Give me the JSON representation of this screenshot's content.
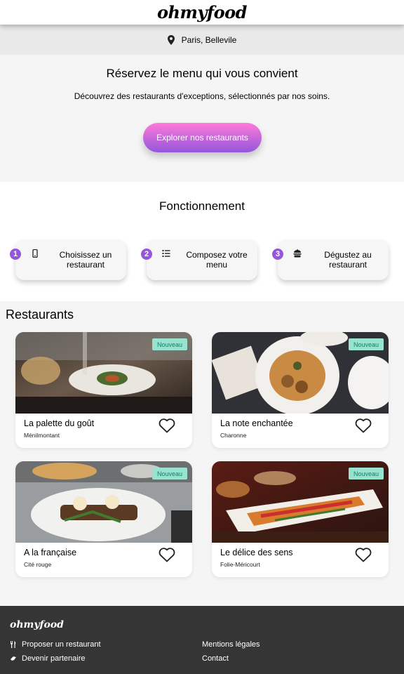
{
  "header": {
    "logo": "ohmyfood"
  },
  "location": {
    "icon": "map-pin-icon",
    "text": "Paris, Bellevile"
  },
  "hero": {
    "title": "Réservez le menu qui vous convient",
    "subtitle": "Découvrez des restaurants d'exceptions, sélectionnés par nos soins.",
    "cta_label": "Explorer nos restaurants"
  },
  "how": {
    "title": "Fonctionnement",
    "steps": [
      {
        "number": "1",
        "icon": "phone-icon",
        "label": "Choisissez un restaurant"
      },
      {
        "number": "2",
        "icon": "list-icon",
        "label": "Composez votre menu"
      },
      {
        "number": "3",
        "icon": "dish-icon",
        "label": "Dégustez au restaurant"
      }
    ]
  },
  "restaurants": {
    "title": "Restaurants",
    "badge": "Nouveau",
    "items": [
      {
        "name": "La palette du goût",
        "area": "Ménilmontant"
      },
      {
        "name": "La note enchantée",
        "area": "Charonne"
      },
      {
        "name": "A la française",
        "area": "Cité rouge"
      },
      {
        "name": "Le délice des sens",
        "area": "Folie-Méricourt"
      }
    ]
  },
  "footer": {
    "logo": "ohmyfood",
    "links": [
      {
        "icon": "utensils-icon",
        "label": "Proposer un restaurant"
      },
      {
        "icon": "handshake-icon",
        "label": "Devenir partenaire"
      },
      {
        "label": "Mentions légales"
      },
      {
        "label": "Contact"
      }
    ]
  },
  "colors": {
    "accent_start": "#ff79da",
    "accent_end": "#9356dc",
    "badge_bg": "#99e2d0",
    "badge_text": "#008766",
    "footer_bg": "#353535"
  }
}
